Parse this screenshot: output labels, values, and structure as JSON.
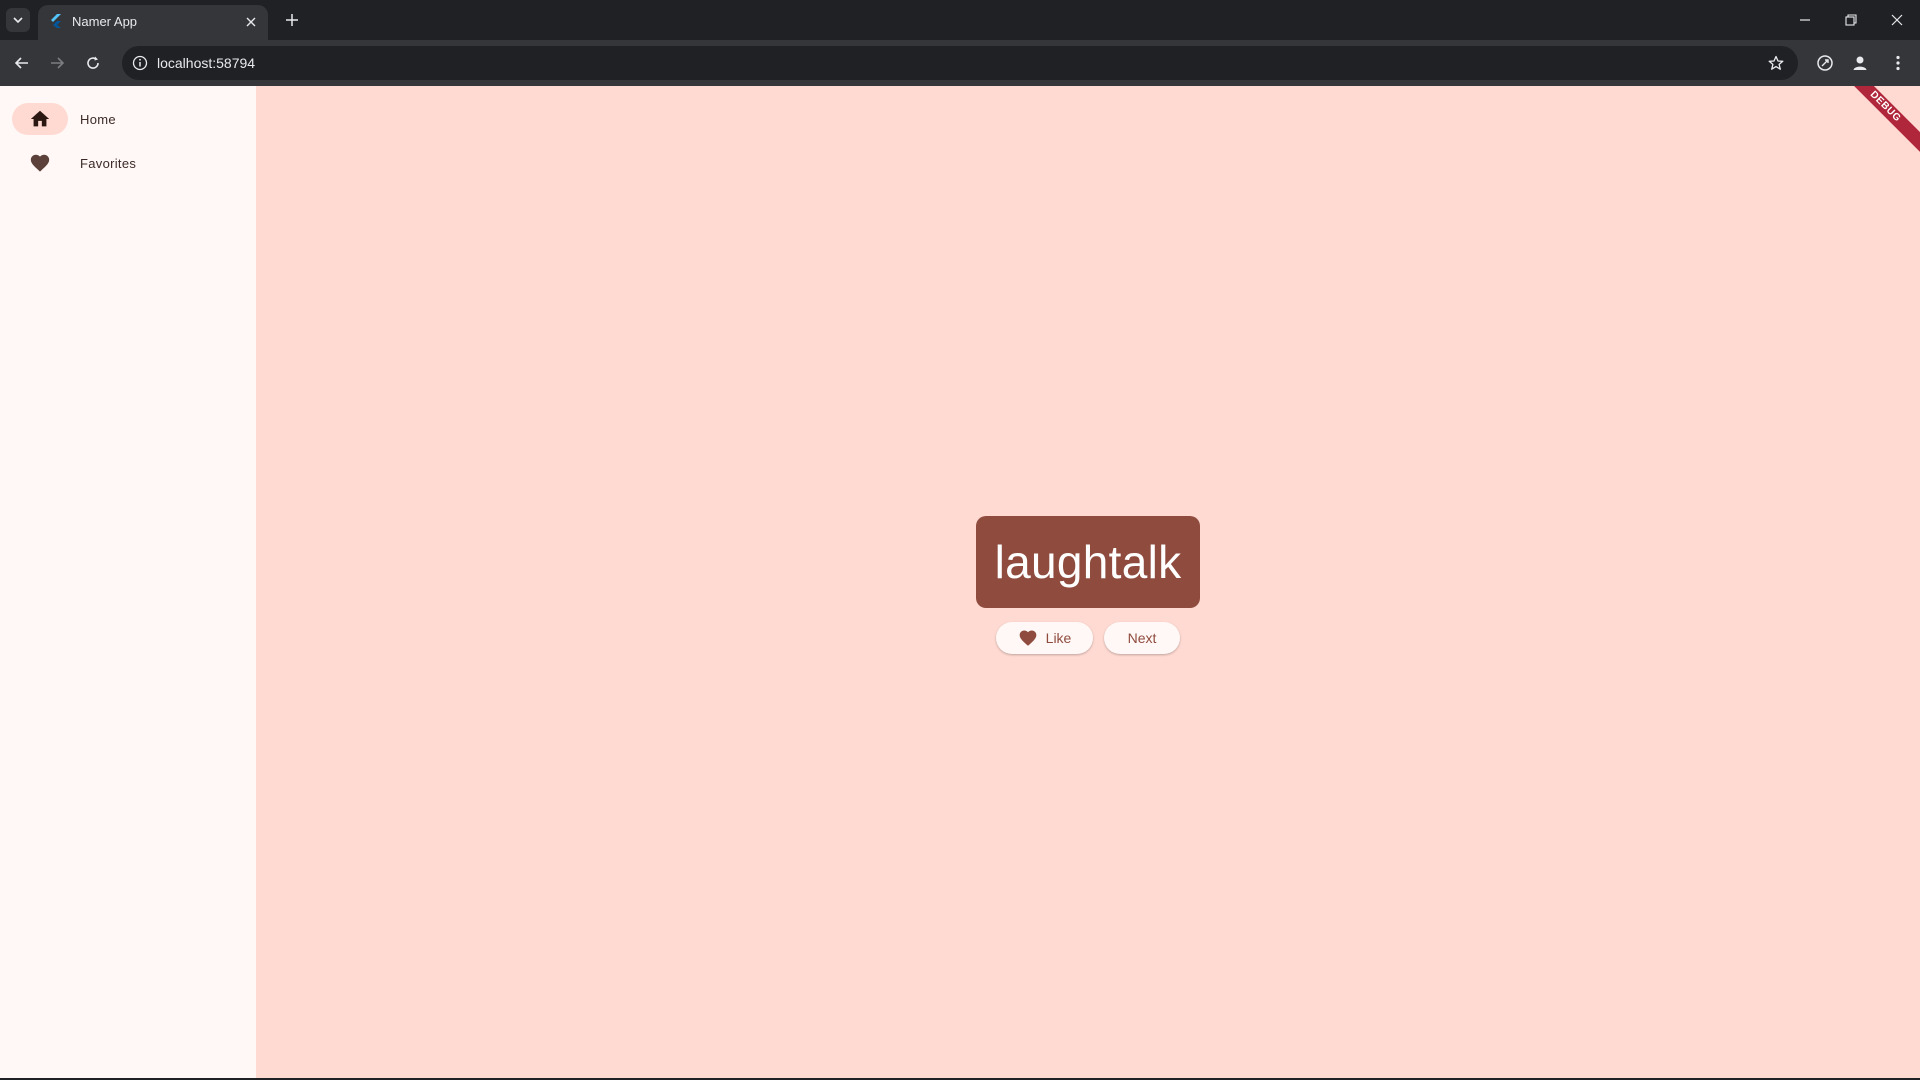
{
  "browser": {
    "tab_title": "Namer App",
    "url": "localhost:58794"
  },
  "rail": {
    "items": [
      {
        "label": "Home",
        "icon": "home-icon",
        "selected": true
      },
      {
        "label": "Favorites",
        "icon": "heart-icon",
        "selected": false
      }
    ]
  },
  "main": {
    "word": "laughtalk",
    "like_label": "Like",
    "next_label": "Next"
  },
  "debug_banner": "DEBUG",
  "colors": {
    "primary": "#8f4c3e",
    "background": "#ffdad2",
    "rail_background": "#fff8f6",
    "button_background": "#fff8f6",
    "chrome_dark": "#202124",
    "chrome_toolbar": "#35363a"
  }
}
